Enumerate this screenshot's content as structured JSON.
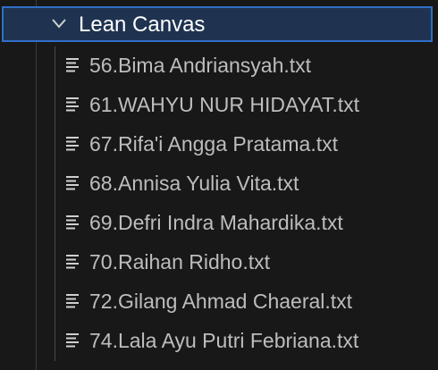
{
  "explorer": {
    "folder": {
      "label": "Lean Canvas",
      "expanded": true,
      "icon": "chevron-down-icon"
    },
    "files": [
      {
        "label": "56.Bima Andriansyah.txt",
        "icon": "text-file-icon"
      },
      {
        "label": "61.WAHYU NUR HIDAYAT.txt",
        "icon": "text-file-icon"
      },
      {
        "label": "67.Rifa'i Angga Pratama.txt",
        "icon": "text-file-icon"
      },
      {
        "label": "68.Annisa Yulia Vita.txt",
        "icon": "text-file-icon"
      },
      {
        "label": "69.Defri Indra Mahardika.txt",
        "icon": "text-file-icon"
      },
      {
        "label": "70.Raihan Ridho.txt",
        "icon": "text-file-icon"
      },
      {
        "label": "72.Gilang Ahmad Chaeral.txt",
        "icon": "text-file-icon"
      },
      {
        "label": "74.Lala Ayu Putri Febriana.txt",
        "icon": "text-file-icon"
      }
    ]
  },
  "colors": {
    "background": "#181818",
    "selection_border": "#2f6fc8",
    "selection_fill": "#1f3350",
    "folder_text": "#ffffff",
    "file_text": "#bdbdbd"
  }
}
